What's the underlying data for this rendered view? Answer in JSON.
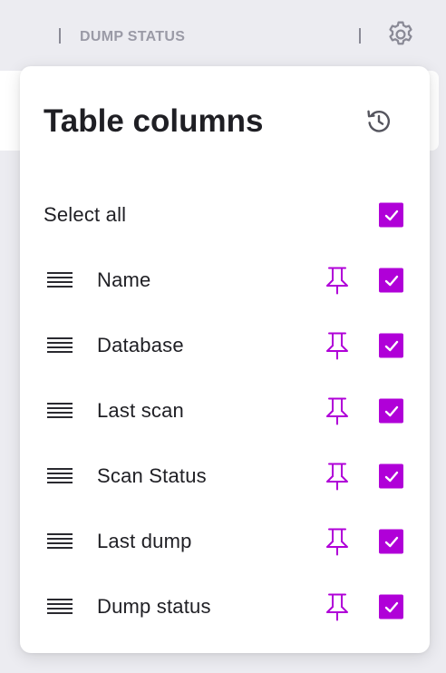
{
  "header": {
    "column_title": "DUMP STATUS",
    "settings_icon": "gear-icon"
  },
  "panel": {
    "title": "Table columns",
    "reset_icon": "history-icon",
    "select_all": {
      "label": "Select all",
      "checked": true
    },
    "columns": [
      {
        "label": "Name",
        "pinned": false,
        "checked": true
      },
      {
        "label": "Database",
        "pinned": false,
        "checked": true
      },
      {
        "label": "Last scan",
        "pinned": false,
        "checked": true
      },
      {
        "label": "Scan Status",
        "pinned": false,
        "checked": true
      },
      {
        "label": "Last dump",
        "pinned": false,
        "checked": true
      },
      {
        "label": "Dump status",
        "pinned": false,
        "checked": true
      }
    ]
  },
  "colors": {
    "accent": "#b000d8",
    "text": "#1f1f24",
    "muted": "#9a9aa6",
    "background": "#ececf1"
  }
}
